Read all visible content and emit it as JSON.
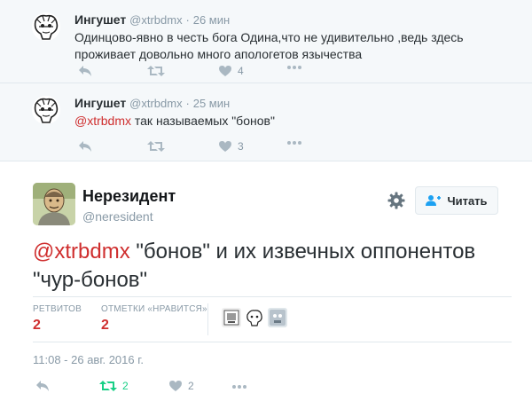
{
  "replies": [
    {
      "name": "Ингушет",
      "screen_name": "@xtrbdmx",
      "dot": "·",
      "time": "26 мин",
      "text": "Одинцово-явно в честь бога Одина,что не удивительно ,ведь здесь проживает довольно много апологетов язычества",
      "mention": "",
      "likes": "4"
    },
    {
      "name": "Ингушет",
      "screen_name": "@xtrbdmx",
      "dot": "·",
      "time": "25 мин",
      "mention": "@xtrbdmx",
      "text": " так называемых \"бонов\"",
      "likes": "3"
    }
  ],
  "main": {
    "name": "Нерезидент",
    "screen_name": "@neresident",
    "follow_label": "Читать",
    "mention": "@xtrbdmx",
    "text": " \"бонов\" и их извечных оппонентов \"чур-бонов\"",
    "retweets_label": "РЕТВИТОВ",
    "retweets": "2",
    "likes_label": "ОТМЕТКИ «НРАВИТСЯ»",
    "likes": "2",
    "date": "11:08 - 26 авг. 2016 г.",
    "action_retweets": "2",
    "action_likes": "2"
  },
  "colors": {
    "accent": "#cf2e2e",
    "retweeted": "#19cf86",
    "muted": "#8899a6",
    "reply_bg": "#f5f8fa"
  },
  "icons": [
    "reply-icon",
    "retweet-icon",
    "heart-icon",
    "more-icon",
    "gear-icon",
    "follow-person-icon"
  ]
}
